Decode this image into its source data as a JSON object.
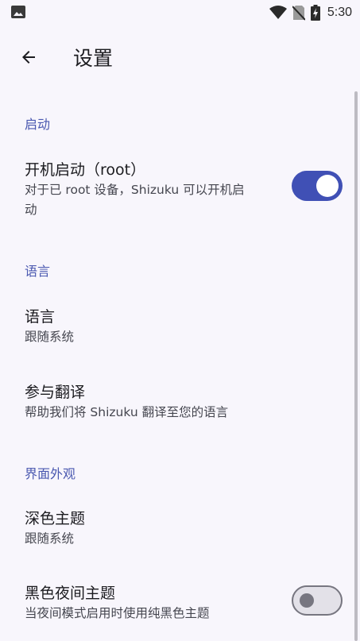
{
  "status_bar": {
    "time": "5:30",
    "icons": [
      "image-notification-icon",
      "wifi-icon",
      "no-sim-icon",
      "battery-charging-icon"
    ]
  },
  "app_bar": {
    "title": "设置",
    "back_icon": "arrow-back-icon"
  },
  "sections": {
    "startup": {
      "header": "启动",
      "boot_start": {
        "title": "开机启动（root）",
        "summary_line1": "对于已 root 设备，Shizuku 可以开机启",
        "summary_line2": "动",
        "enabled": true
      }
    },
    "language": {
      "header": "语言",
      "language_item": {
        "title": "语言",
        "summary": "跟随系统"
      },
      "translate_item": {
        "title": "参与翻译",
        "summary": "帮助我们将 Shizuku 翻译至您的语言"
      }
    },
    "appearance": {
      "header": "界面外观",
      "dark_theme": {
        "title": "深色主题",
        "summary": "跟随系统"
      },
      "black_night_theme": {
        "title": "黑色夜间主题",
        "summary": "当夜间模式启用时使用纯黑色主题",
        "enabled": false
      }
    }
  },
  "colors": {
    "accent": "#4050b5",
    "category_text": "#4a58b0",
    "background": "#f8f6fc"
  }
}
